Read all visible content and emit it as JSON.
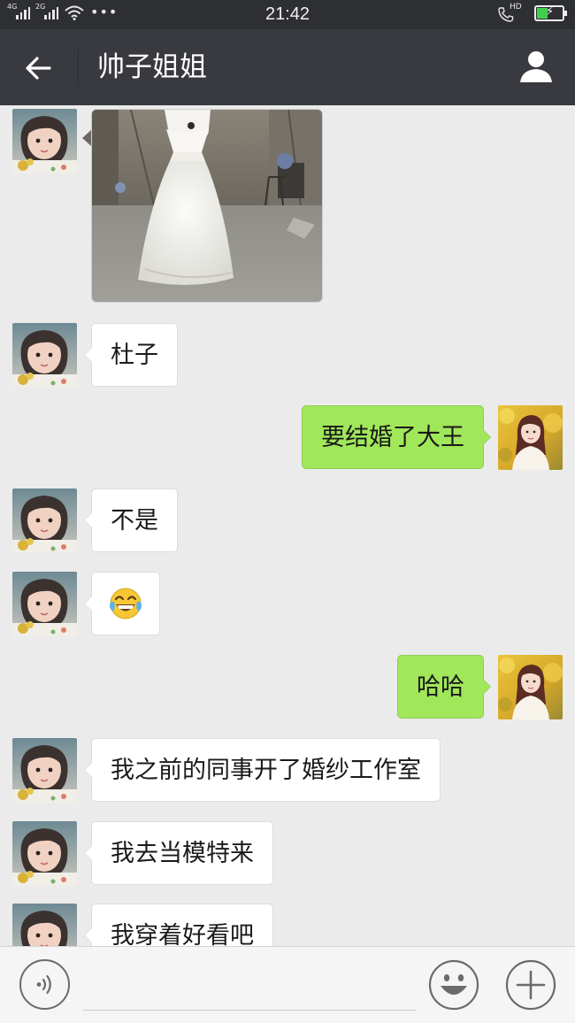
{
  "status_bar": {
    "network_1": "4G",
    "network_2": "2G",
    "time": "21:42",
    "call_badge": "HD",
    "battery_level": 0.4,
    "icons": [
      "signal-icon",
      "wifi-icon",
      "more-dots-icon",
      "hd-call-icon",
      "battery-charging-icon"
    ]
  },
  "header": {
    "title": "帅子姐姐",
    "back_icon": "arrow-left-icon",
    "contact_icon": "person-icon"
  },
  "messages": [
    {
      "from": "them",
      "type": "image",
      "content": "wedding-dress-photo"
    },
    {
      "from": "them",
      "type": "text",
      "text": "杜子"
    },
    {
      "from": "me",
      "type": "text",
      "text": "要结婚了大王"
    },
    {
      "from": "them",
      "type": "text",
      "text": "不是"
    },
    {
      "from": "them",
      "type": "emoji",
      "text": "😂"
    },
    {
      "from": "me",
      "type": "text",
      "text": "哈哈"
    },
    {
      "from": "them",
      "type": "text",
      "text": "我之前的同事开了婚纱工作室"
    },
    {
      "from": "them",
      "type": "text",
      "text": "我去当模特来"
    },
    {
      "from": "them",
      "type": "text",
      "text": "我穿着好看吧"
    }
  ],
  "input_bar": {
    "value": "",
    "icons": [
      "voice-icon",
      "emoji-icon",
      "plus-icon"
    ]
  },
  "colors": {
    "status_bg": "#2e2f33",
    "header_bg": "#393a3f",
    "chat_bg": "#ebebeb",
    "bubble_in": "#ffffff",
    "bubble_out": "#a0e75a",
    "input_bg": "#f5f5f5"
  }
}
